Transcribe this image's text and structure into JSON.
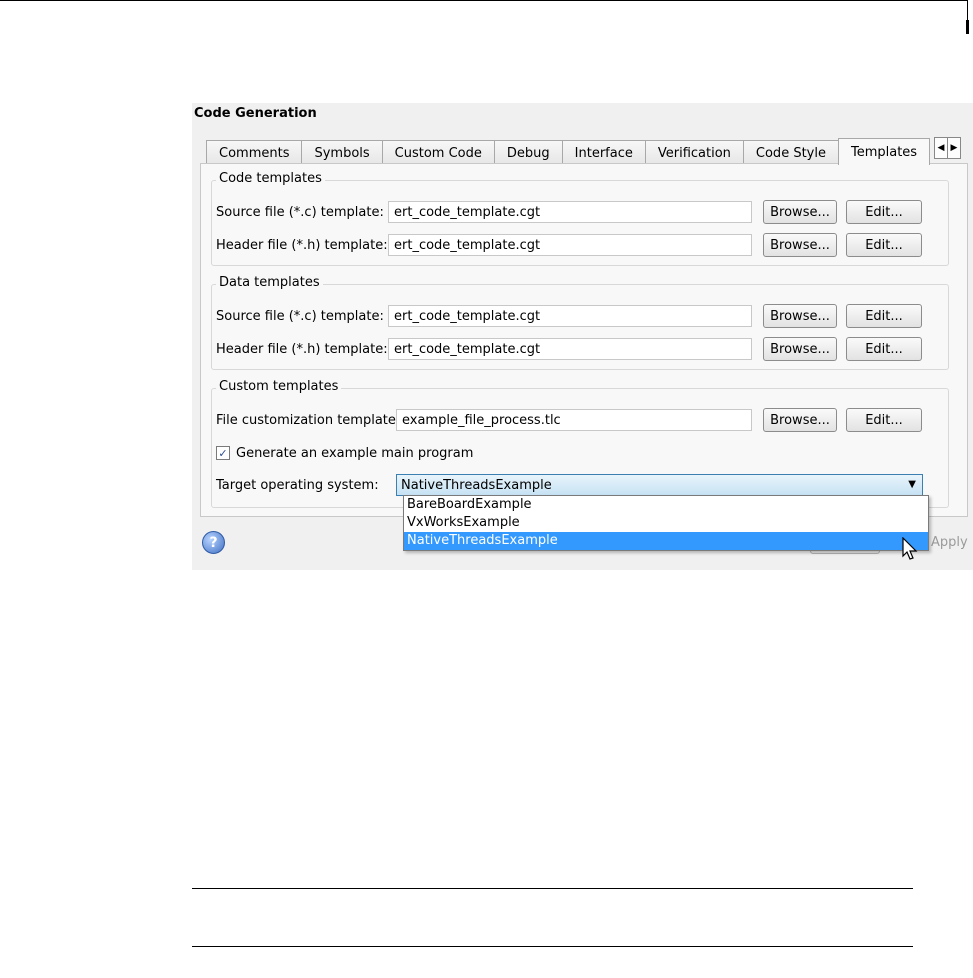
{
  "panel": {
    "title": "Code Generation"
  },
  "tabs": [
    {
      "label": "Comments"
    },
    {
      "label": "Symbols"
    },
    {
      "label": "Custom Code"
    },
    {
      "label": "Debug"
    },
    {
      "label": "Interface"
    },
    {
      "label": "Verification"
    },
    {
      "label": "Code Style"
    },
    {
      "label": "Templates",
      "active": true
    }
  ],
  "tab_scroll": {
    "left": "◀",
    "right": "▶"
  },
  "code_templates": {
    "title": "Code templates",
    "source_label": "Source file (*.c) template:",
    "source_value": "ert_code_template.cgt",
    "header_label": "Header file (*.h) template:",
    "header_value": "ert_code_template.cgt"
  },
  "data_templates": {
    "title": "Data templates",
    "source_label": "Source file (*.c) template:",
    "source_value": "ert_code_template.cgt",
    "header_label": "Header file (*.h) template:",
    "header_value": "ert_code_template.cgt"
  },
  "custom_templates": {
    "title": "Custom templates",
    "file_label": "File customization template:",
    "file_value": "example_file_process.tlc",
    "generate_label": "Generate an example main program",
    "generate_checked": true,
    "target_label": "Target operating system:",
    "target_value": "NativeThreadsExample",
    "target_options": [
      "BareBoardExample",
      "VxWorksExample",
      "NativeThreadsExample"
    ]
  },
  "buttons": {
    "browse": "Browse...",
    "edit": "Edit...",
    "apply": "Apply"
  },
  "icons": {
    "help": "?",
    "checkmark": "✓",
    "dropdown_arrow": "▼"
  }
}
